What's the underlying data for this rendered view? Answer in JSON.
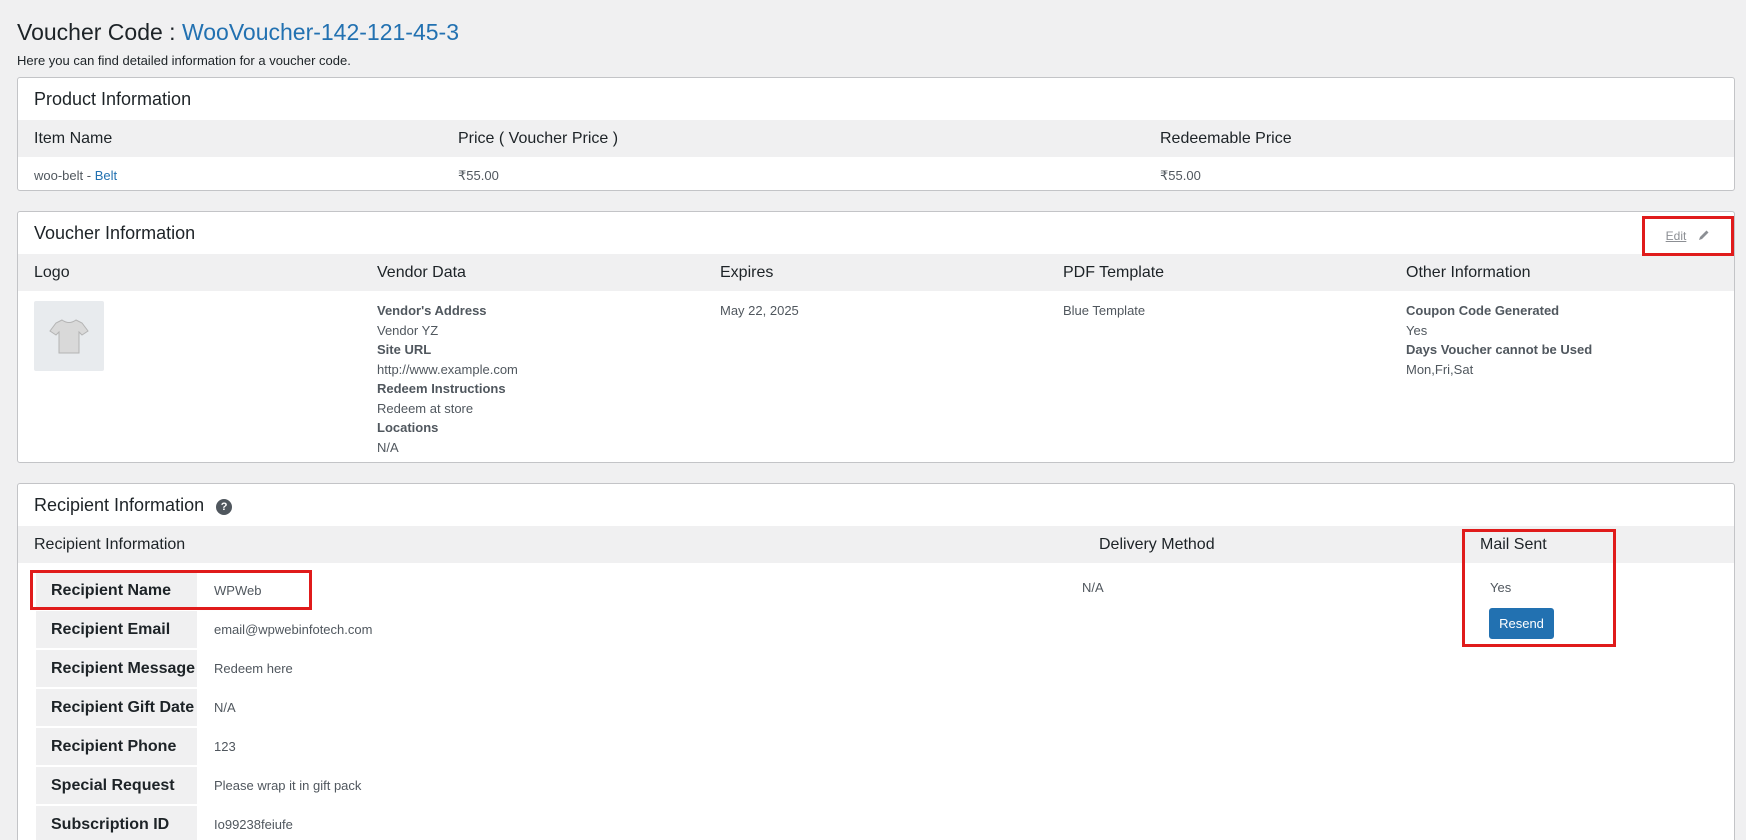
{
  "header": {
    "title_prefix": "Voucher Code :",
    "voucher_code": "WooVoucher-142-121-45-3",
    "description": "Here you can find detailed information for a voucher code."
  },
  "product": {
    "title": "Product Information",
    "columns": [
      "Item Name",
      "Price ( Voucher Price )",
      "Redeemable Price"
    ],
    "row": {
      "item_prefix": "woo-belt - ",
      "item_link": "Belt",
      "price": "₹55.00",
      "redeemable": "₹55.00"
    }
  },
  "voucher": {
    "title": "Voucher Information",
    "edit_label": "Edit",
    "columns": [
      "Logo",
      "Vendor Data",
      "Expires",
      "PDF Template",
      "Other Information"
    ],
    "vendor": [
      {
        "label": "Vendor's Address",
        "value": "Vendor YZ"
      },
      {
        "label": "Site URL",
        "value": "http://www.example.com"
      },
      {
        "label": "Redeem Instructions",
        "value": "Redeem at store"
      },
      {
        "label": "Locations",
        "value": "N/A"
      }
    ],
    "expires": "May 22, 2025",
    "pdf_template": "Blue Template",
    "other": [
      {
        "label": "Coupon Code Generated",
        "value": "Yes"
      },
      {
        "label": "Days Voucher cannot be Used",
        "value": "Mon,Fri,Sat"
      }
    ]
  },
  "recipient": {
    "title": "Recipient Information",
    "help_icon": "?",
    "columns": [
      "Recipient Information",
      "Delivery Method",
      "Mail Sent"
    ],
    "rows": [
      {
        "label": "Recipient Name",
        "value": "WPWeb"
      },
      {
        "label": "Recipient Email",
        "value": "email@wpwebinfotech.com"
      },
      {
        "label": "Recipient Message",
        "value": "Redeem here"
      },
      {
        "label": "Recipient Gift Date",
        "value": "N/A"
      },
      {
        "label": "Recipient Phone",
        "value": "123"
      },
      {
        "label": "Special Request",
        "value": "Please wrap it in gift pack"
      },
      {
        "label": "Subscription ID",
        "value": "Io99238feiufe"
      }
    ],
    "delivery_method": "N/A",
    "mail_sent": "Yes",
    "resend_label": "Resend"
  },
  "colors": {
    "accent": "#2271b1",
    "highlight": "#e01b1b",
    "background": "#f0f0f1"
  }
}
